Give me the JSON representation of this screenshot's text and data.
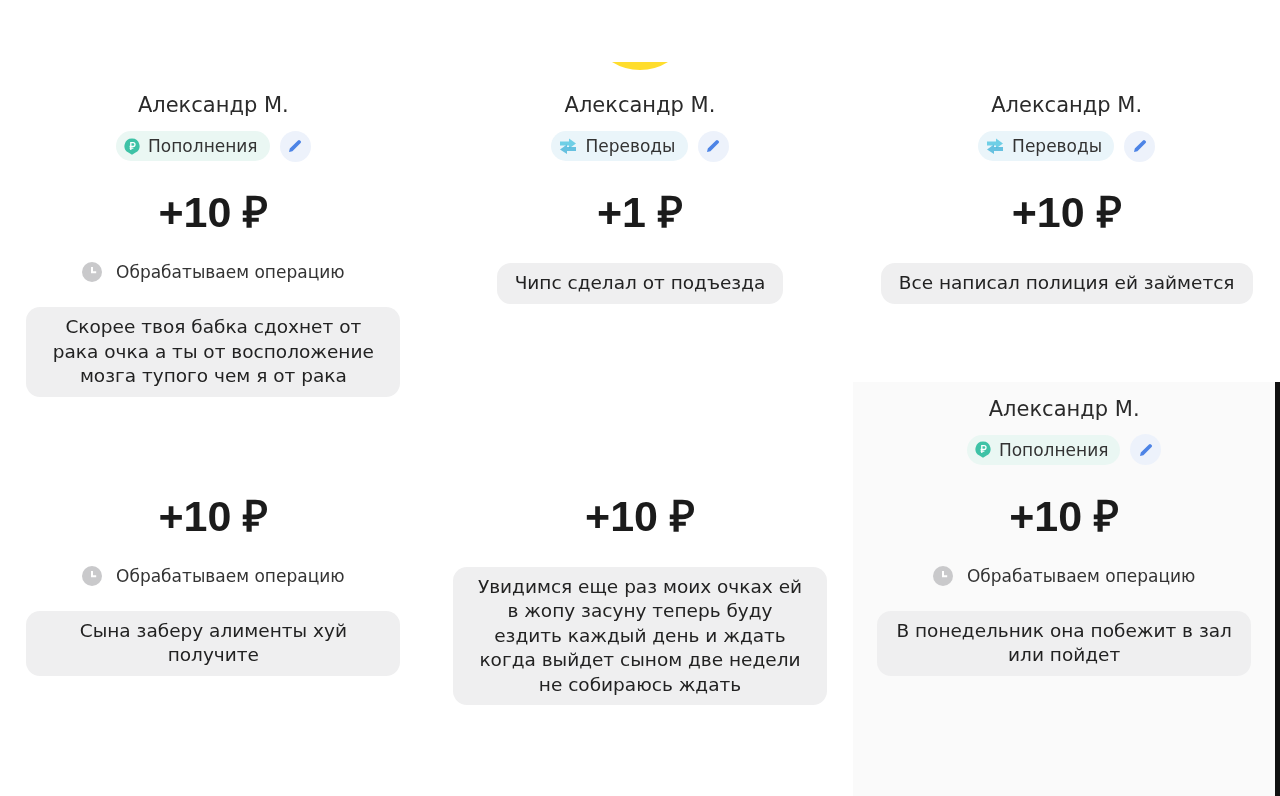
{
  "transactions": [
    {
      "name": "Александр М.",
      "category": {
        "label": "Пополнения",
        "kind": "topup"
      },
      "amount": "+10 ₽",
      "status": "Обрабатываем операцию",
      "comment": "Скорее твоя бабка сдохнет от рака очка а ты от восположение мозга тупого чем я от рака"
    },
    {
      "avatar": true,
      "name": "Александр М.",
      "category": {
        "label": "Переводы",
        "kind": "transfer"
      },
      "amount": "+1 ₽",
      "comment": "Чипс сделал от подъезда"
    },
    {
      "name": "Александр М.",
      "category": {
        "label": "Переводы",
        "kind": "transfer"
      },
      "amount": "+10 ₽",
      "comment": "Все написал полиция ей займется"
    },
    {
      "amount": "+10 ₽",
      "status": "Обрабатываем операцию",
      "comment": "Сына заберу алименты хуй получите"
    },
    {
      "amount": "+10 ₽",
      "comment": "Увидимся еще раз моих очках ей в жопу засуну теперь буду ездить каждый день и ждать когда выйдет сыном две недели не собираюсь ждать"
    },
    {
      "name": "Александр М.",
      "category": {
        "label": "Пополнения",
        "kind": "topup"
      },
      "amount": "+10 ₽",
      "status": "Обрабатываем операцию",
      "comment": "В понедельник она побежит в зал или пойдет"
    }
  ]
}
